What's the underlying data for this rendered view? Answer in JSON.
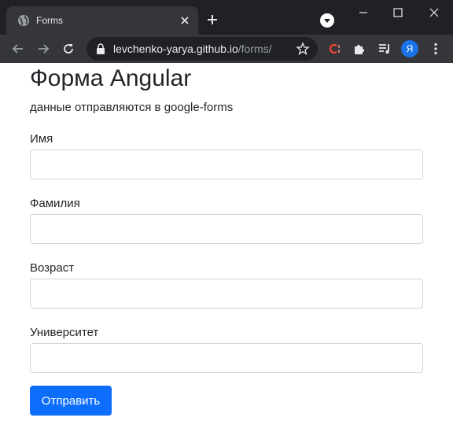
{
  "browser": {
    "tab_title": "Forms",
    "url_host": "levchenko-yarya.github.io",
    "url_path": "/forms/",
    "profile_initial": "Я"
  },
  "page": {
    "title": "Форма Angular",
    "subtitle": "данные отправляются в google-forms",
    "fields": [
      {
        "label": "Имя",
        "value": ""
      },
      {
        "label": "Фамилия",
        "value": ""
      },
      {
        "label": "Возраст",
        "value": ""
      },
      {
        "label": "Университет",
        "value": ""
      }
    ],
    "submit_label": "Отправить"
  },
  "colors": {
    "chrome_dark": "#202124",
    "chrome_tab": "#35363a",
    "primary_button": "#0d6efd",
    "input_border": "#ced4da"
  }
}
